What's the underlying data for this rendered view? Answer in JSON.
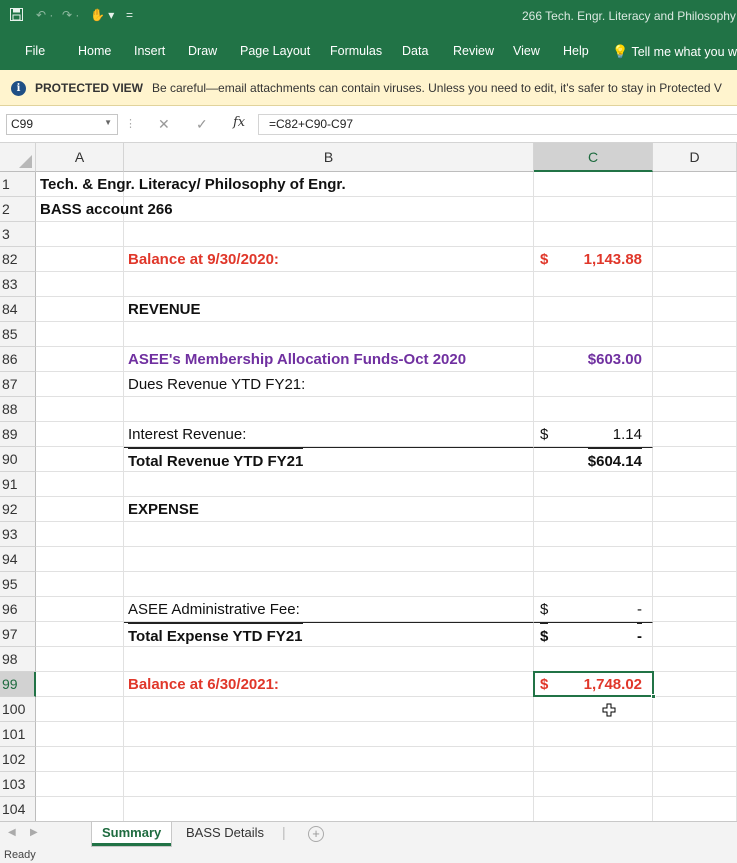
{
  "app": {
    "window_title": "266 Tech. Engr. Literacy and Philosophy",
    "brand_color": "#217346"
  },
  "quick_access": {
    "save_icon": "save-icon",
    "undo_icon": "undo-icon",
    "redo_icon": "redo-icon",
    "touch_icon": "touch-mode-icon",
    "customize_icon": "customize-icon"
  },
  "ribbon": {
    "tabs": [
      "File",
      "Home",
      "Insert",
      "Draw",
      "Page Layout",
      "Formulas",
      "Data",
      "Review",
      "View",
      "Help"
    ],
    "tell_me": "Tell me what you w"
  },
  "protected_view": {
    "title": "PROTECTED VIEW",
    "message": "Be careful—email attachments can contain viruses. Unless you need to edit, it's safer to stay in Protected V"
  },
  "formula_bar": {
    "name_box": "C99",
    "fx_label": "fx",
    "formula": "=C82+C90-C97"
  },
  "columns": [
    "A",
    "B",
    "C",
    "D"
  ],
  "selected_column": "C",
  "selected_row": "99",
  "rows": [
    {
      "num": "1",
      "a": "Tech. & Engr. Literacy/ Philosophy of Engr.",
      "b": "",
      "c_cur": "",
      "c_amt": ""
    },
    {
      "num": "2",
      "a": "BASS account 266",
      "b": "",
      "c_cur": "",
      "c_amt": ""
    },
    {
      "num": "3",
      "a": "",
      "b": "",
      "c_cur": "",
      "c_amt": ""
    },
    {
      "num": "82",
      "a": "",
      "b": "Balance at 9/30/2020:",
      "c_cur": "$",
      "c_amt": "1,143.88"
    },
    {
      "num": "83",
      "a": "",
      "b": "",
      "c_cur": "",
      "c_amt": ""
    },
    {
      "num": "84",
      "a": "",
      "b": "REVENUE",
      "c_cur": "",
      "c_amt": ""
    },
    {
      "num": "85",
      "a": "",
      "b": "",
      "c_cur": "",
      "c_amt": ""
    },
    {
      "num": "86",
      "a": "",
      "b": "ASEE's Membership Allocation Funds-Oct 2020",
      "c_cur": "",
      "c_amt": "$603.00"
    },
    {
      "num": "87",
      "a": "",
      "b": "Dues Revenue YTD FY21:",
      "c_cur": "",
      "c_amt": ""
    },
    {
      "num": "88",
      "a": "",
      "b": "",
      "c_cur": "",
      "c_amt": ""
    },
    {
      "num": "89",
      "a": "",
      "b": " Interest Revenue:",
      "c_cur": "$",
      "c_amt": "1.14"
    },
    {
      "num": "90",
      "a": "",
      "b": "Total Revenue YTD FY21",
      "c_cur": "",
      "c_amt": "$604.14"
    },
    {
      "num": "91",
      "a": "",
      "b": "",
      "c_cur": "",
      "c_amt": ""
    },
    {
      "num": "92",
      "a": "",
      "b": "EXPENSE",
      "c_cur": "",
      "c_amt": ""
    },
    {
      "num": "93",
      "a": "",
      "b": "",
      "c_cur": "",
      "c_amt": ""
    },
    {
      "num": "94",
      "a": "",
      "b": "",
      "c_cur": "",
      "c_amt": ""
    },
    {
      "num": "95",
      "a": "",
      "b": "",
      "c_cur": "",
      "c_amt": ""
    },
    {
      "num": "96",
      "a": "",
      "b": "ASEE Administrative Fee:",
      "c_cur": "$",
      "c_amt": "-"
    },
    {
      "num": "97",
      "a": "",
      "b": "Total Expense YTD FY21",
      "c_cur": "$",
      "c_amt": "-"
    },
    {
      "num": "98",
      "a": "",
      "b": "",
      "c_cur": "",
      "c_amt": ""
    },
    {
      "num": "99",
      "a": "",
      "b": "Balance at 6/30/2021:",
      "c_cur": "$",
      "c_amt": "1,748.02"
    },
    {
      "num": "100",
      "a": "",
      "b": "",
      "c_cur": "",
      "c_amt": ""
    },
    {
      "num": "101",
      "a": "",
      "b": "",
      "c_cur": "",
      "c_amt": ""
    },
    {
      "num": "102",
      "a": "",
      "b": "",
      "c_cur": "",
      "c_amt": ""
    },
    {
      "num": "103",
      "a": "",
      "b": "",
      "c_cur": "",
      "c_amt": ""
    },
    {
      "num": "104",
      "a": "",
      "b": "",
      "c_cur": "",
      "c_amt": ""
    }
  ],
  "sheets": {
    "tabs": [
      "Summary",
      "BASS Details"
    ],
    "active": "Summary",
    "add_icon": "plus-circle-icon"
  },
  "status": {
    "text": "Ready"
  },
  "colors": {
    "red_text": "#e0372a",
    "purple_text": "#7030a0",
    "protected_bar": "#fff4ce"
  }
}
